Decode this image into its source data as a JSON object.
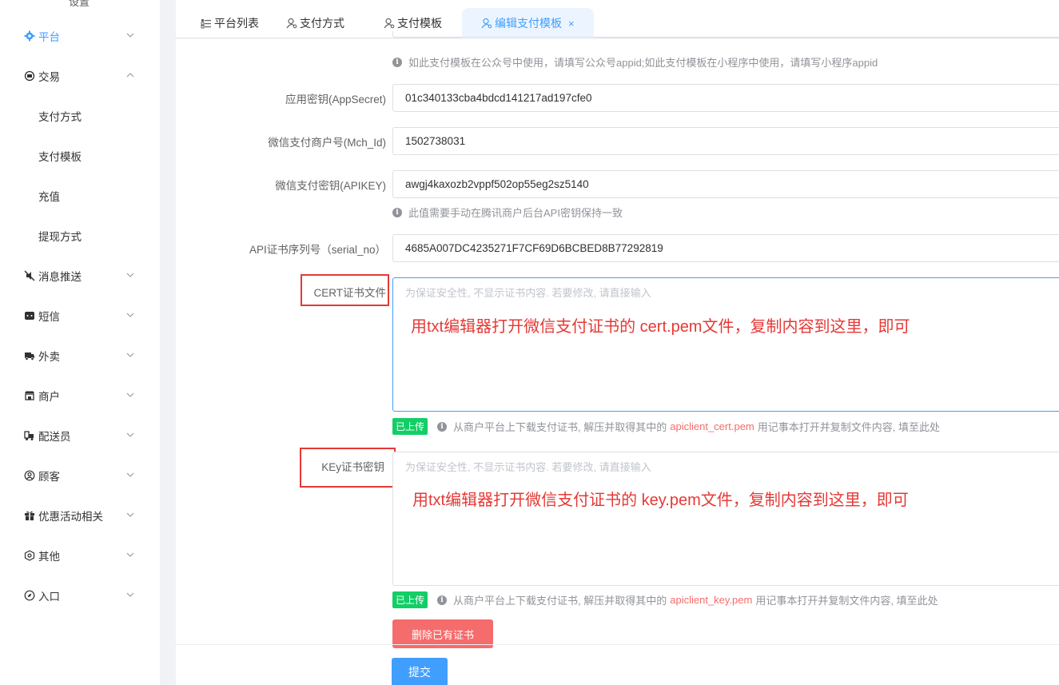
{
  "sidebar": {
    "cut_title": "设置",
    "items": [
      {
        "label": "平台",
        "icon": "gear-icon",
        "expanded": false
      },
      {
        "label": "交易",
        "icon": "trade-icon",
        "expanded": true
      },
      {
        "label": "消息推送",
        "icon": "mute-icon",
        "expanded": false
      },
      {
        "label": "短信",
        "icon": "sms-icon",
        "expanded": false
      },
      {
        "label": "外卖",
        "icon": "delivery-truck-icon",
        "expanded": false
      },
      {
        "label": "商户",
        "icon": "shop-icon",
        "expanded": false
      },
      {
        "label": "配送员",
        "icon": "courier-icon",
        "expanded": false
      },
      {
        "label": "顾客",
        "icon": "user-circle-icon",
        "expanded": false
      },
      {
        "label": "优惠活动相关",
        "icon": "gift-icon",
        "expanded": false
      },
      {
        "label": "其他",
        "icon": "hexagon-icon",
        "expanded": false
      },
      {
        "label": "入口",
        "icon": "compass-icon",
        "expanded": false
      }
    ],
    "subitems": [
      "支付方式",
      "支付模板",
      "充值",
      "提现方式"
    ]
  },
  "tabs": [
    {
      "label": "平台列表",
      "icon": "list-icon"
    },
    {
      "label": "支付方式",
      "icon": "user-gear-icon"
    },
    {
      "label": "支付模板",
      "icon": "user-gear-icon"
    },
    {
      "label": "编辑支付模板",
      "icon": "user-gear-icon",
      "active": true,
      "close": "×"
    }
  ],
  "form": {
    "appid_tip": "如此支付模板在公众号中使用，请填写公众号appid;如此支付模板在小程序中使用，请填写小程序appid",
    "appsecret_label": "应用密钥(AppSecret)",
    "appsecret_value": "01c340133cba4bdcd141217ad197cfe0",
    "mchid_label": "微信支付商户号(Mch_Id)",
    "mchid_value": "1502738031",
    "apikey_label": "微信支付密钥(APIKEY)",
    "apikey_value": "awgj4kaxozb2vppf502op55eg2sz5140",
    "apikey_tip": "此值需要手动在腾讯商户后台API密钥保持一致",
    "serial_label": "API证书序列号（serial_no）",
    "serial_value": "4685A007DC4235271F7CF69D6BCBED8B77292819",
    "cert_label": "CERT证书文件",
    "cert_placeholder": "为保证安全性, 不显示证书内容. 若要修改, 请直接输入",
    "cert_annotation": "用txt编辑器打开微信支付证书的 cert.pem文件，复制内容到这里，即可",
    "cert_badge": "已上传",
    "cert_tip_pre": "从商户平台上下载支付证书, 解压并取得其中的",
    "cert_tip_file": "apiclient_cert.pem",
    "cert_tip_post": "用记事本打开并复制文件内容, 填至此处",
    "key_label": "KEy证书密钥",
    "key_placeholder": "为保证安全性, 不显示证书内容. 若要修改, 请直接输入",
    "key_annotation": "用txt编辑器打开微信支付证书的 key.pem文件，复制内容到这里，即可",
    "key_badge": "已上传",
    "key_tip_pre": "从商户平台上下载支付证书, 解压并取得其中的",
    "key_tip_file": "apiclient_key.pem",
    "key_tip_post": "用记事本打开并复制文件内容, 填至此处",
    "delete_button": "删除已有证书",
    "submit_button": "提交"
  },
  "colors": {
    "primary": "#409eff",
    "danger": "#f56c6c",
    "success": "#13ce66",
    "annotation": "#e53935"
  }
}
